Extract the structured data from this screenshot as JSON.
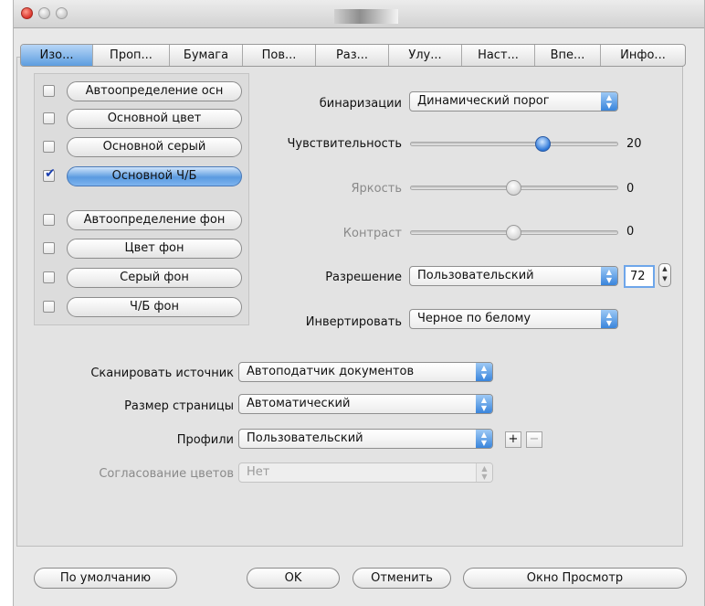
{
  "tabs": [
    {
      "label": "Изо..."
    },
    {
      "label": "Проп..."
    },
    {
      "label": "Бумага"
    },
    {
      "label": "Пов..."
    },
    {
      "label": "Раз..."
    },
    {
      "label": "Улу..."
    },
    {
      "label": "Наст..."
    },
    {
      "label": "Впе..."
    },
    {
      "label": "Инфо..."
    }
  ],
  "image_types": [
    {
      "label": "Автоопределение осн",
      "checked": false
    },
    {
      "label": "Основной цвет",
      "checked": false
    },
    {
      "label": "Основной серый",
      "checked": false
    },
    {
      "label": "Основной Ч/Б",
      "checked": true
    },
    {
      "label": "Автоопределение фон",
      "checked": false
    },
    {
      "label": "Цвет фон",
      "checked": false
    },
    {
      "label": "Серый фон",
      "checked": false
    },
    {
      "label": "Ч/Б фон",
      "checked": false
    }
  ],
  "settings": {
    "binarization_label": "бинаризации",
    "binarization_value": "Динамический порог",
    "sensitivity_label": "Чувствительность",
    "sensitivity_value": "20",
    "brightness_label": "Яркость",
    "brightness_value": "0",
    "contrast_label": "Контраст",
    "contrast_value": "0",
    "resolution_label": "Разрешение",
    "resolution_value": "Пользовательский",
    "resolution_number": "72",
    "invert_label": "Инвертировать",
    "invert_value": "Черное по белому"
  },
  "scan": {
    "source_label": "Сканировать источник",
    "source_value": "Автоподатчик документов",
    "page_size_label": "Размер страницы",
    "page_size_value": "Автоматический",
    "profiles_label": "Профили",
    "profiles_value": "Пользовательский",
    "add_symbol": "+",
    "remove_symbol": "−",
    "color_matching_label": "Согласование цветов",
    "color_matching_value": "Нет"
  },
  "buttons": {
    "defaults": "По умолчанию",
    "ok": "OK",
    "cancel": "Отменить",
    "preview": "Окно Просмотр"
  },
  "icons": {
    "checkmark": "✔",
    "popup_arrows": "▲▼"
  },
  "colors": {
    "accent_blue": "#5b9be0"
  }
}
